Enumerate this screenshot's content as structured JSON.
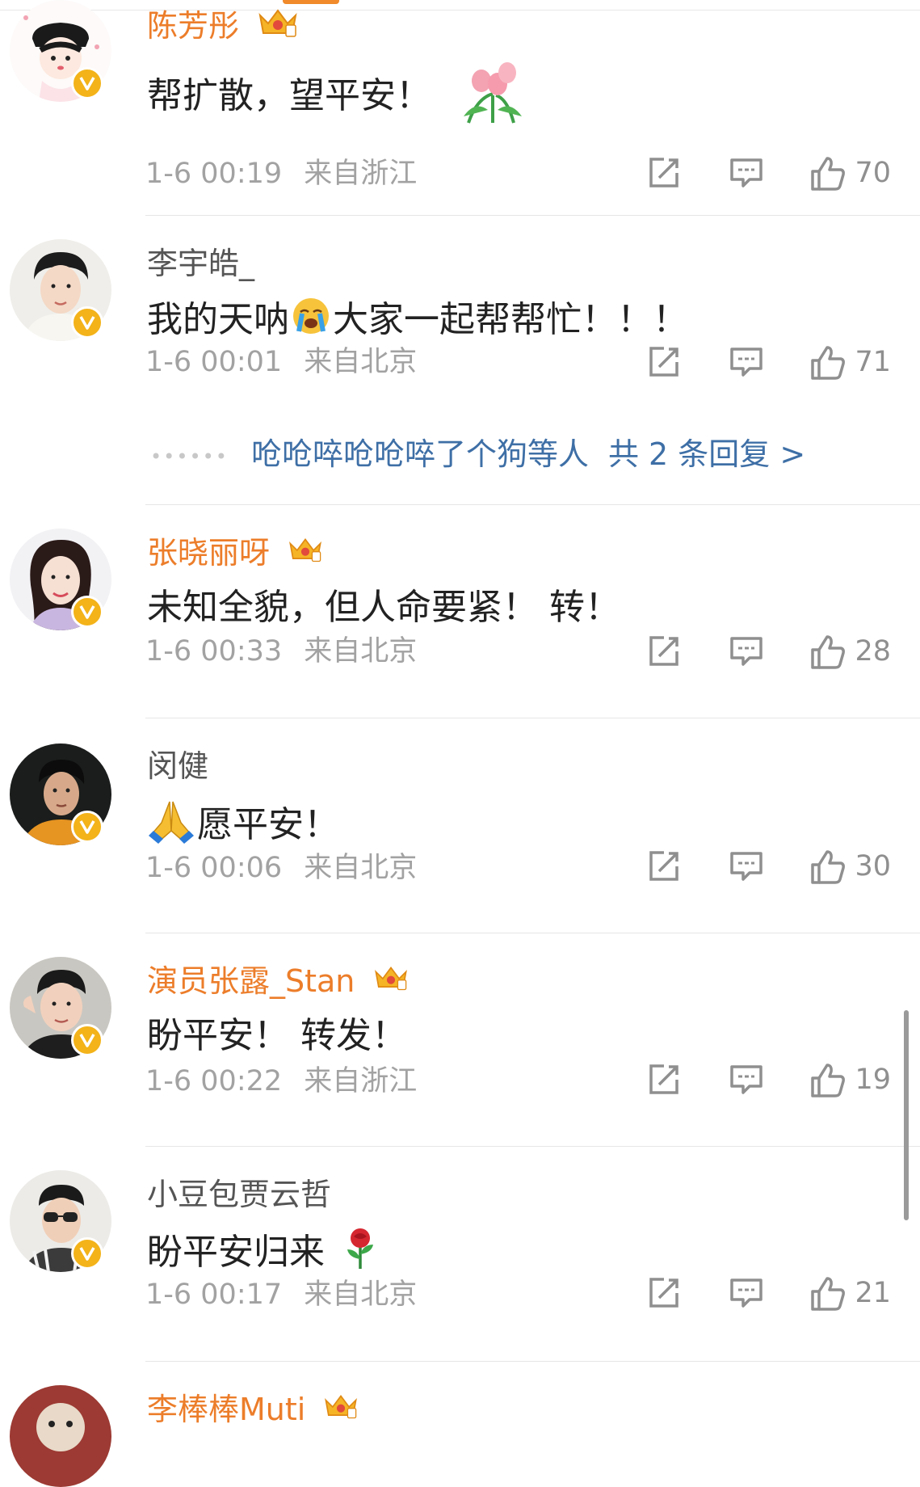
{
  "comments": [
    {
      "username": "陈芳彤",
      "vip": true,
      "text": "帮扩散，望平安！",
      "time": "1-6 00:19",
      "location": "来自浙江",
      "likes": "70",
      "emoji": "tulip-icon"
    },
    {
      "username": "李宇皓_",
      "vip": false,
      "text_before": "我的天呐",
      "text_after": "大家一起帮帮忙！！！",
      "time": "1-6 00:01",
      "location": "来自北京",
      "likes": "71",
      "emoji": "crying-face-icon",
      "replies_users": "呛呛啐呛呛啐了个狗等人",
      "replies_count": "共 2 条回复 >"
    },
    {
      "username": "张晓丽呀",
      "vip": true,
      "text": "未知全貌，但人命要紧！ 转！",
      "time": "1-6 00:33",
      "location": "来自北京",
      "likes": "28"
    },
    {
      "username": "闵健",
      "vip": false,
      "text": "愿平安！",
      "time": "1-6 00:06",
      "location": "来自北京",
      "likes": "30",
      "emoji": "praying-hands-icon"
    },
    {
      "username": "演员张露_Stan",
      "vip": true,
      "text": "盼平安！ 转发！",
      "time": "1-6 00:22",
      "location": "来自浙江",
      "likes": "19"
    },
    {
      "username": "小豆包贾云哲",
      "vip": false,
      "text": "盼平安归来",
      "time": "1-6 00:17",
      "location": "来自北京",
      "likes": "21",
      "emoji": "rose-icon"
    },
    {
      "username": "李棒棒Muti",
      "vip": true
    }
  ],
  "colors": {
    "vip_name": "#ec7d2a",
    "reply_link": "#3e6fa6",
    "badge": "#f3b319",
    "meta": "#a2a2a2"
  }
}
